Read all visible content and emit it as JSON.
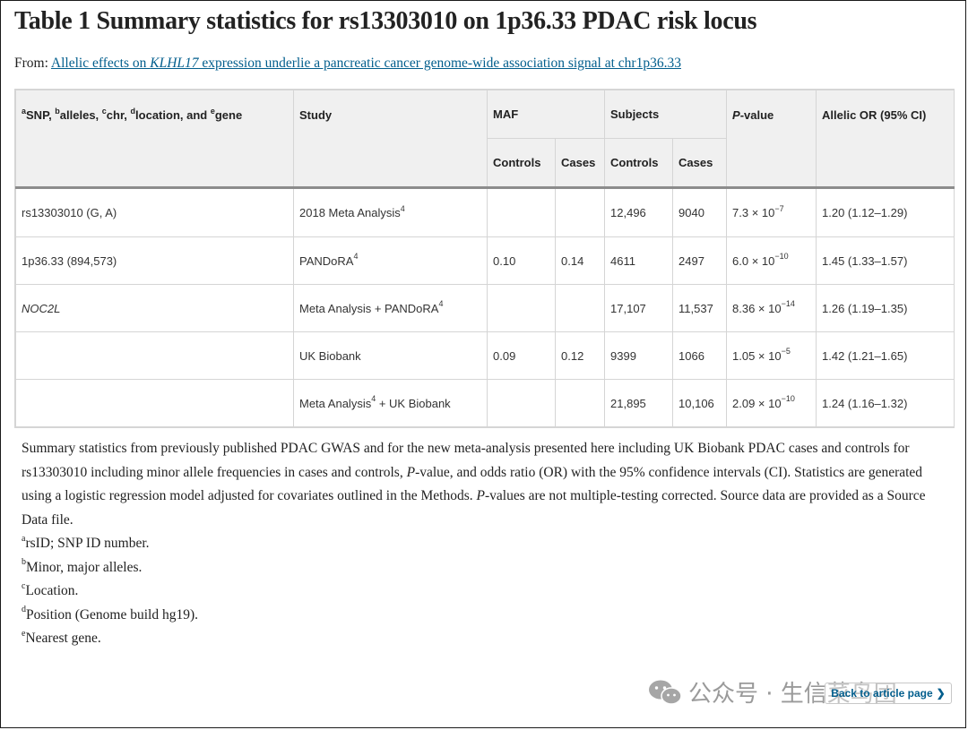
{
  "title": "Table 1 Summary statistics for rs13303010 on 1p36.33 PDAC risk locus",
  "from": {
    "label": "From: ",
    "link_pre": "Allelic effects on ",
    "link_gene": "KLHL17",
    "link_post": " expression underlie a pancreatic cancer genome-wide association signal at chr1p36.33"
  },
  "table": {
    "headers": {
      "snp": {
        "sup_a": "a",
        "t_a": "SNP, ",
        "sup_b": "b",
        "t_b": "alleles, ",
        "sup_c": "c",
        "t_c": "chr, ",
        "sup_d": "d",
        "t_d": "location, and ",
        "sup_e": "e",
        "t_e": "gene"
      },
      "study": "Study",
      "maf": "MAF",
      "subjects": "Subjects",
      "pvalue_p": "P",
      "pvalue_rest": "-value",
      "or": "Allelic OR (95% CI)",
      "controls": "Controls",
      "cases": "Cases"
    },
    "rows": [
      {
        "snp": "rs13303010 (G, A)",
        "study": "2018 Meta Analysis",
        "study_sup": "4",
        "study_post": "",
        "maf_controls": "",
        "maf_cases": "",
        "subj_controls": "12,496",
        "subj_cases": "9040",
        "p_base": "7.3 × 10",
        "p_exp": "−7",
        "or": "1.20 (1.12–1.29)"
      },
      {
        "snp": "1p36.33 (894,573)",
        "study": "PANDoRA",
        "study_sup": "4",
        "study_post": "",
        "maf_controls": "0.10",
        "maf_cases": "0.14",
        "subj_controls": "4611",
        "subj_cases": "2497",
        "p_base": "6.0 × 10",
        "p_exp": "−10",
        "or": "1.45 (1.33–1.57)"
      },
      {
        "snp": "NOC2L",
        "study": "Meta Analysis + PANDoRA",
        "study_sup": "4",
        "study_post": "",
        "maf_controls": "",
        "maf_cases": "",
        "subj_controls": "17,107",
        "subj_cases": "11,537",
        "p_base": "8.36 × 10",
        "p_exp": "−14",
        "or": "1.26 (1.19–1.35)"
      },
      {
        "snp": "",
        "study": "UK Biobank",
        "study_sup": "",
        "study_post": "",
        "maf_controls": "0.09",
        "maf_cases": "0.12",
        "subj_controls": "9399",
        "subj_cases": "1066",
        "p_base": "1.05 × 10",
        "p_exp": "−5",
        "or": "1.42 (1.21–1.65)"
      },
      {
        "snp": "",
        "study": "Meta Analysis",
        "study_sup": "4",
        "study_post": " + UK Biobank",
        "maf_controls": "",
        "maf_cases": "",
        "subj_controls": "21,895",
        "subj_cases": "10,106",
        "p_base": "2.09 × 10",
        "p_exp": "−10",
        "or": "1.24 (1.16–1.32)"
      }
    ]
  },
  "caption": {
    "s1": "Summary statistics from previously published PDAC GWAS and for the new meta-analysis presented here including UK Biobank PDAC cases and controls for rs13303010 including minor allele frequencies in cases and controls, ",
    "p1": "P",
    "s2": "-value, and odds ratio (OR) with the 95% confidence intervals (CI). Statistics are generated using a logistic regression model adjusted for covariates outlined in the Methods. ",
    "p2": "P",
    "s3": "-values are not multiple-testing corrected. Source data are provided as a Source Data file."
  },
  "footnotes": [
    {
      "sup": "a",
      "text": "rsID; SNP ID number."
    },
    {
      "sup": "b",
      "text": "Minor, major alleles."
    },
    {
      "sup": "c",
      "text": "Location."
    },
    {
      "sup": "d",
      "text": "Position (Genome build hg19)."
    },
    {
      "sup": "e",
      "text": "Nearest gene."
    }
  ],
  "watermark": {
    "text": "公众号 · 生信菜鸟团",
    "icon": "wechat-icon"
  },
  "back_link": {
    "label": "Back to article page",
    "icon": "chevron-right-icon"
  }
}
